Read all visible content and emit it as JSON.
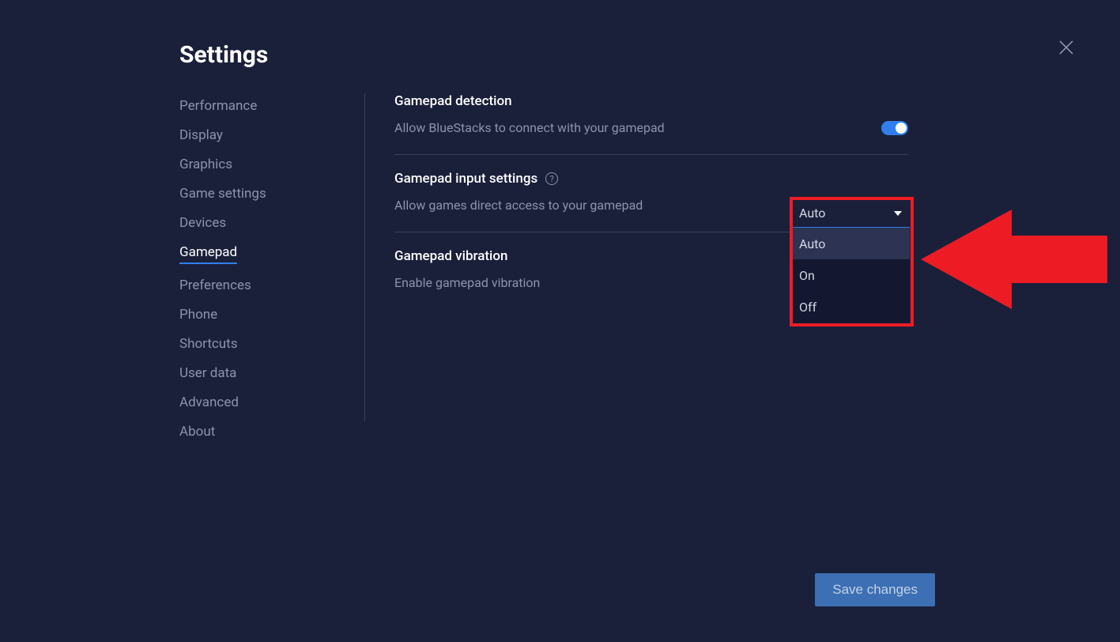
{
  "title": "Settings",
  "save_button": "Save changes",
  "sidebar": {
    "items": [
      {
        "label": "Performance"
      },
      {
        "label": "Display"
      },
      {
        "label": "Graphics"
      },
      {
        "label": "Game settings"
      },
      {
        "label": "Devices"
      },
      {
        "label": "Gamepad"
      },
      {
        "label": "Preferences"
      },
      {
        "label": "Phone"
      },
      {
        "label": "Shortcuts"
      },
      {
        "label": "User data"
      },
      {
        "label": "Advanced"
      },
      {
        "label": "About"
      }
    ],
    "active_index": 5
  },
  "sections": {
    "detection": {
      "title": "Gamepad detection",
      "desc": "Allow BlueStacks to connect with your gamepad",
      "toggle_on": true
    },
    "input": {
      "title": "Gamepad input settings",
      "desc": "Allow games direct access to your gamepad",
      "dropdown": {
        "selected": "Auto",
        "options": [
          "Auto",
          "On",
          "Off"
        ],
        "highlighted_index": 0
      }
    },
    "vibration": {
      "title": "Gamepad vibration",
      "desc": "Enable gamepad vibration"
    }
  },
  "annotation": {
    "arrow_color": "#ed1c24",
    "box_color": "#ed1c24"
  }
}
